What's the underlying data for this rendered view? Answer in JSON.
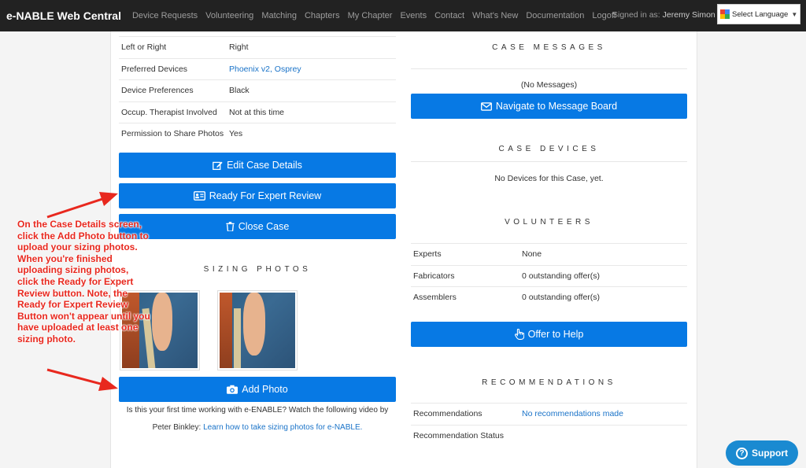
{
  "navbar": {
    "brand": "e-NABLE Web Central",
    "links": [
      "Device Requests",
      "Volunteering",
      "Matching",
      "Chapters",
      "My Chapter",
      "Events",
      "Contact",
      "What's New",
      "Documentation",
      "Logoff"
    ],
    "signed_in_prefix": "Signed in as: ",
    "user": "Jeremy Simon",
    "language": "Select Language"
  },
  "details": [
    {
      "label": "Left or Right",
      "value": "Right"
    },
    {
      "label": "Preferred Devices",
      "value": "Phoenix v2, Osprey"
    },
    {
      "label": "Device Preferences",
      "value": "Black"
    },
    {
      "label": "Occup. Therapist Involved",
      "value": "Not at this time"
    },
    {
      "label": "Permission to Share Photos",
      "value": "Yes"
    }
  ],
  "buttons": {
    "edit": "Edit Case Details",
    "ready": "Ready For Expert Review",
    "close": "Close Case",
    "add_photo": "Add Photo",
    "navigate": "Navigate to Message Board",
    "offer": "Offer to Help"
  },
  "sizing": {
    "title": "SIZING PHOTOS",
    "caption_line1": "Is this your first time working with e-ENABLE? Watch the following video by",
    "caption_line2_prefix": "Peter Binkley: ",
    "caption_link": "Learn how to take sizing photos for e-NABLE."
  },
  "case_messages": {
    "title": "CASE MESSAGES",
    "empty": "(No Messages)"
  },
  "case_devices": {
    "title": "CASE DEVICES",
    "empty": "No Devices for this Case, yet."
  },
  "volunteers": {
    "title": "VOLUNTEERS",
    "rows": [
      {
        "label": "Experts",
        "value": "None"
      },
      {
        "label": "Fabricators",
        "value": "0 outstanding offer(s)"
      },
      {
        "label": "Assemblers",
        "value": "0 outstanding offer(s)"
      }
    ]
  },
  "recommendations": {
    "title": "RECOMMENDATIONS",
    "rows": [
      {
        "label": "Recommendations",
        "value": "No recommendations made"
      },
      {
        "label": "Recommendation Status",
        "value": ""
      }
    ]
  },
  "annotation": "On the Case Details screen, click the Add Photo button to upload your sizing photos. When you're finished uploading sizing photos, click the Ready for Expert Review button. Note, the Ready for Expert Review Button won't appear until you have uploaded at least one sizing photo.",
  "support": "Support",
  "colors": {
    "primary": "#0779e4",
    "annotation": "#e8281e",
    "navbar": "#222222",
    "link": "#1a73c8"
  }
}
